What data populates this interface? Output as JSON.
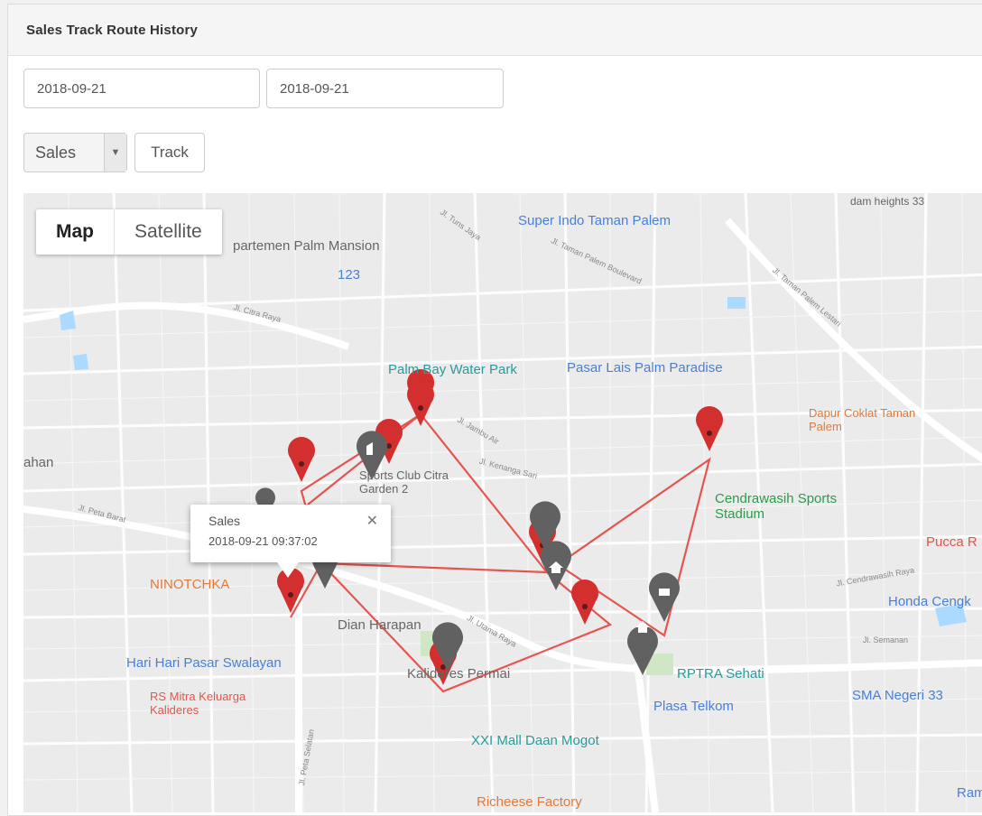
{
  "header": {
    "title": "Sales Track Route History"
  },
  "filters": {
    "date_from": "2018-09-21",
    "date_to": "2018-09-21",
    "select_value": "Sales",
    "track_label": "Track"
  },
  "map": {
    "type_map": "Map",
    "type_satellite": "Satellite",
    "route_color": "#e53935",
    "pin_red": "#d32f2f",
    "pin_gray": "#616161",
    "pois": [
      {
        "label": "Super Indo Taman Palem",
        "color": "#4a7fd6"
      },
      {
        "label": "partemen Palm Mansion",
        "color": "#666666"
      },
      {
        "label": "123",
        "color": "#4a7fd6"
      },
      {
        "label": "Palm Bay Water Park",
        "color": "#2a9a9a"
      },
      {
        "label": "Pasar Lais Palm Paradise",
        "color": "#4a7fd6"
      },
      {
        "label": "Dapur Coklat Taman Palem",
        "color": "#e07a3a"
      },
      {
        "label": "Sports Club Citra Garden 2",
        "color": "#666666"
      },
      {
        "label": "Cendrawasih Sports Stadium",
        "color": "#2e9a4c"
      },
      {
        "label": "NINOTCHKA",
        "color": "#e07a3a"
      },
      {
        "label": "Dian Harapan",
        "color": "#666666"
      },
      {
        "label": "Hari Hari Pasar Swalayan",
        "color": "#4a7fd6"
      },
      {
        "label": "RS Mitra Keluarga Kalideres",
        "color": "#e0564e"
      },
      {
        "label": "Kalideres Permai",
        "color": "#666666"
      },
      {
        "label": "RPTRA Sehati",
        "color": "#2a9a9a"
      },
      {
        "label": "Plasa Telkom",
        "color": "#4a7fd6"
      },
      {
        "label": "XXI Mall Daan Mogot",
        "color": "#2a9a9a"
      },
      {
        "label": "SMA Negeri 33",
        "color": "#4a7fd6"
      },
      {
        "label": "Honda Cengk",
        "color": "#4a7fd6"
      },
      {
        "label": "Richeese Factory",
        "color": "#e07a3a"
      },
      {
        "label": "Pucca R",
        "color": "#e0564e"
      },
      {
        "label": "Ramay",
        "color": "#4a7fd6"
      },
      {
        "label": "ahan",
        "color": "#666666"
      },
      {
        "label": "dam heights 33",
        "color": "#666666"
      }
    ],
    "streets": [
      "Jl. Taman Palem Lestari",
      "Jl. Tuns Jaya",
      "Jl. Taman Palem Boulevard",
      "Jl. Citra Raya",
      "Jl. Jambu Air",
      "Jl. Kenanga Sari",
      "Jl. Peta Barat",
      "Jl. Utama Raya",
      "Jl. Cendrawasih Raya",
      "Jl. Semanan",
      "Jl. Peta Selatan"
    ],
    "info": {
      "title": "Sales",
      "time": "2018-09-21 09:37:02"
    }
  }
}
